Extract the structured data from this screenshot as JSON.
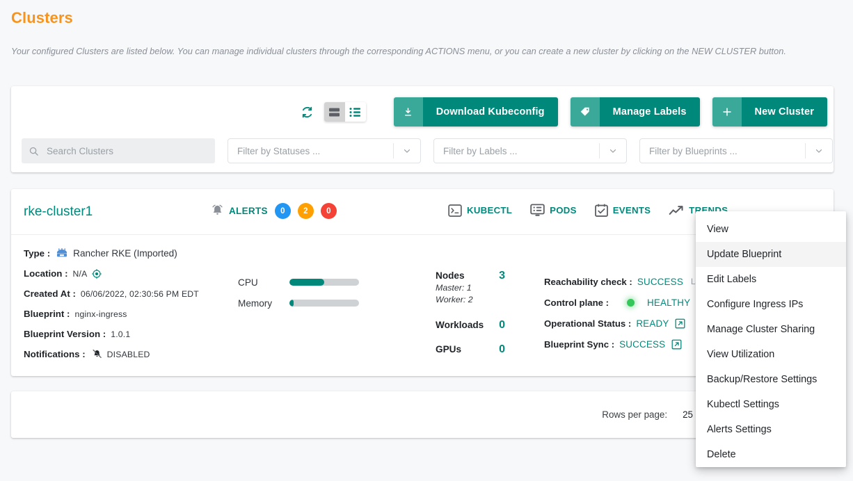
{
  "header": {
    "title": "Clusters",
    "description": "Your configured Clusters are listed below. You can manage individual clusters through the corresponding ACTIONS menu, or you can create a new cluster by clicking on the NEW CLUSTER button."
  },
  "toolbar": {
    "refresh_icon": "refresh-icon",
    "view_card_icon": "card-view-icon",
    "view_list_icon": "list-view-icon",
    "buttons": [
      {
        "label": "Download Kubeconfig",
        "icon": "download-icon"
      },
      {
        "label": "Manage Labels",
        "icon": "tag-icon"
      },
      {
        "label": "New Cluster",
        "icon": "plus-icon"
      }
    ]
  },
  "filters": {
    "search": {
      "placeholder": "Search Clusters",
      "value": "",
      "icon": "search-icon"
    },
    "selects": [
      {
        "label": "Filter by Statuses ...",
        "icon": "chevron-down-icon"
      },
      {
        "label": "Filter by Labels ...",
        "icon": "chevron-down-icon"
      },
      {
        "label": "Filter by Blueprints ...",
        "icon": "chevron-down-icon"
      }
    ]
  },
  "cluster": {
    "name": "rke-cluster1",
    "alerts": {
      "icon": "bell-icon",
      "label": "ALERTS",
      "badges": [
        {
          "count": "0",
          "color": "#2196f3"
        },
        {
          "count": "2",
          "color": "#ffa000"
        },
        {
          "count": "0",
          "color": "#f44336"
        }
      ]
    },
    "actions": [
      {
        "label": "KUBECTL",
        "icon": "terminal-icon"
      },
      {
        "label": "PODS",
        "icon": "pods-icon"
      },
      {
        "label": "EVENTS",
        "icon": "events-icon"
      },
      {
        "label": "TRENDS",
        "icon": "trends-icon"
      }
    ],
    "details": [
      {
        "label": "Type :",
        "value": "Rancher RKE (Imported)",
        "icon": "rancher-rke-icon"
      },
      {
        "label": "Location :",
        "value": "N/A",
        "icon": "location-target-icon"
      },
      {
        "label": "Created At :",
        "value": "06/06/2022, 02:30:56 PM EDT"
      },
      {
        "label": "Blueprint :",
        "value": "nginx-ingress"
      },
      {
        "label": "Blueprint Version :",
        "value": "1.0.1"
      },
      {
        "label": "Notifications :",
        "value": "DISABLED",
        "icon": "bell-off-icon"
      }
    ],
    "usage": [
      {
        "name": "CPU",
        "percent": 50
      },
      {
        "name": "Memory",
        "percent": 6
      }
    ],
    "counts": [
      {
        "name": "Nodes",
        "value": "3",
        "sub": [
          "Master: 1",
          "Worker: 2"
        ]
      },
      {
        "name": "Workloads",
        "value": "0"
      },
      {
        "name": "GPUs",
        "value": "0"
      }
    ],
    "statuses": [
      {
        "label": "Reachability check :",
        "value": "SUCCESS",
        "extra": "Last c"
      },
      {
        "label": "Control plane :",
        "value": "HEALTHY",
        "dot": "#34c759"
      },
      {
        "label": "Operational Status :",
        "value": "READY",
        "icon": "external-link-icon"
      },
      {
        "label": "Blueprint Sync :",
        "value": "SUCCESS",
        "icon": "external-link-icon"
      }
    ]
  },
  "footer": {
    "rows_per_page_label": "Rows per page:",
    "rows_per_page_value": "25",
    "caret_icon": "caret-down-icon"
  },
  "actions_menu": {
    "items": [
      {
        "label": "View",
        "hovered": false
      },
      {
        "label": "Update Blueprint",
        "hovered": true
      },
      {
        "label": "Edit Labels",
        "hovered": false
      },
      {
        "label": "Configure Ingress IPs",
        "hovered": false
      },
      {
        "label": "Manage Cluster Sharing",
        "hovered": false
      },
      {
        "label": "View Utilization",
        "hovered": false
      },
      {
        "label": "Backup/Restore Settings",
        "hovered": false
      },
      {
        "label": "Kubectl Settings",
        "hovered": false
      },
      {
        "label": "Alerts Settings",
        "hovered": false
      },
      {
        "label": "Delete",
        "hovered": false
      }
    ]
  },
  "colors": {
    "accent_teal": "#00897b",
    "teal_light": "#3aa99a",
    "title_orange": "#f7941e"
  }
}
